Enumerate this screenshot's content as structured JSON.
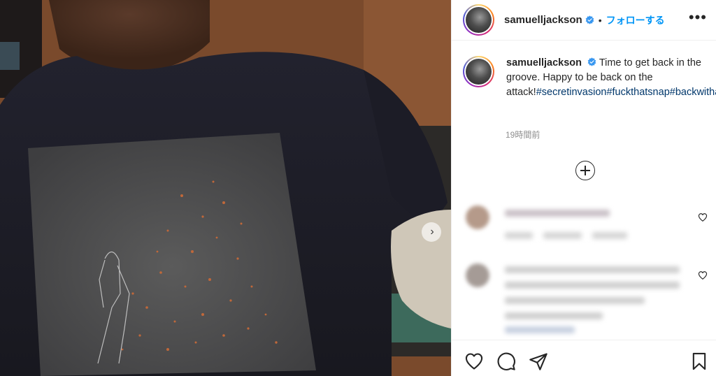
{
  "post": {
    "username": "samuelljackson",
    "separator": "•",
    "follow_label": "フォローする",
    "more_label": "•••",
    "caption_text": "Time to get back in the groove. Happy to be back on the attack!",
    "hashtags": [
      "#secretinvasion",
      "#fuckthatsnap",
      "#backwithafury"
    ],
    "time": "19時間前"
  },
  "icons": {
    "verified": "verified-badge-icon",
    "more": "more-options-icon",
    "next": "chevron-right-icon",
    "load_more": "plus-circle-icon",
    "like": "heart-icon",
    "comment": "comment-bubble-icon",
    "share": "paper-plane-icon",
    "save": "bookmark-icon"
  },
  "colors": {
    "accent": "#0095f6",
    "verified": "#3897f0",
    "hashtag": "#00376b",
    "muted": "#8e8e8e"
  }
}
